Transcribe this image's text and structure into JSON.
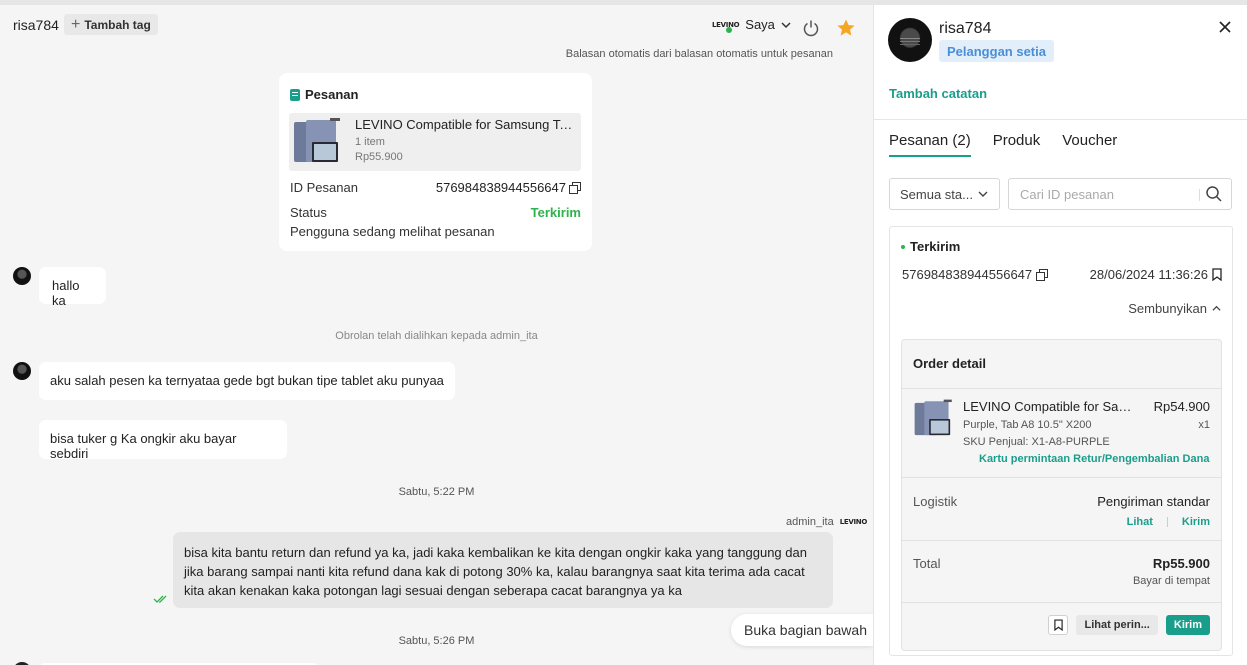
{
  "chat": {
    "username": "risa784",
    "tag_button_label": "Tambah tag",
    "agent_logo_text": "LEVINO",
    "agent_name": "Saya",
    "auto_reply_note": "Balasan otomatis dari balasan otomatis untuk pesanan",
    "order_card": {
      "title": "Pesanan",
      "product_name": "LEVINO Compatible for Samsung Ta...",
      "item_count": "1 item",
      "price": "Rp55.900",
      "id_label": "ID Pesanan",
      "id_value": "576984838944556647",
      "status_label": "Status",
      "status_value": "Terkirim",
      "viewing_note": "Pengguna sedang melihat pesanan"
    },
    "messages": [
      {
        "from": "customer",
        "text": "hallo ka"
      },
      {
        "from": "customer",
        "text": "aku salah pesen ka ternyataa gede bgt bukan tipe tablet aku punyaa"
      },
      {
        "from": "customer",
        "text": "bisa tuker g Ka ongkir aku bayar sebdiri"
      },
      {
        "from": "agent",
        "text": "bisa kita bantu return dan refund ya ka, jadi kaka kembalikan ke kita dengan ongkir kaka yang tanggung dan jika barang sampai nanti kita refund dana kak di potong 30% ka, kalau barangnya saat kita terima ada cacat kita akan kenakan kaka potongan lagi sesuai dengan seberapa cacat barangnya ya ka"
      }
    ],
    "transfer_note": "Obrolan telah dialihkan kepada admin_ita",
    "timestamp_1": "Sabtu, 5:22 PM",
    "agent_sender": "admin_ita",
    "timestamp_2": "Sabtu, 5:26 PM",
    "jump_bottom_label": "Buka bagian bawah"
  },
  "panel": {
    "username": "risa784",
    "badge": "Pelanggan setia",
    "add_note": "Tambah catatan",
    "tabs": [
      "Pesanan (2)",
      "Produk",
      "Voucher"
    ],
    "active_tab": 0,
    "status_filter": "Semua sta...",
    "search_placeholder": "Cari ID pesanan",
    "order": {
      "status": "Terkirim",
      "id": "576984838944556647",
      "datetime": "28/06/2024 11:36:26",
      "hide_label": "Sembunyikan",
      "detail_title": "Order detail",
      "product_name": "LEVINO Compatible for Sam...",
      "product_price": "Rp54.900",
      "variant": "Purple, Tab A8 10.5\" X200",
      "qty": "x1",
      "sku": "SKU Penjual: X1-A8-PURPLE",
      "return_link": "Kartu permintaan Retur/Pengembalian Dana",
      "logistics_label": "Logistik",
      "logistics_value": "Pengiriman standar",
      "view_link": "Lihat",
      "send_link": "Kirim",
      "total_label": "Total",
      "total_value": "Rp55.900",
      "payment": "Bayar di tempat",
      "details_button": "Lihat perin...",
      "send_button": "Kirim"
    }
  },
  "colors": {
    "accent": "#1a9e8c",
    "success": "#2db34a",
    "star": "#f5a623",
    "badge_bg": "#e3eefb",
    "badge_text": "#4a8fd6"
  }
}
